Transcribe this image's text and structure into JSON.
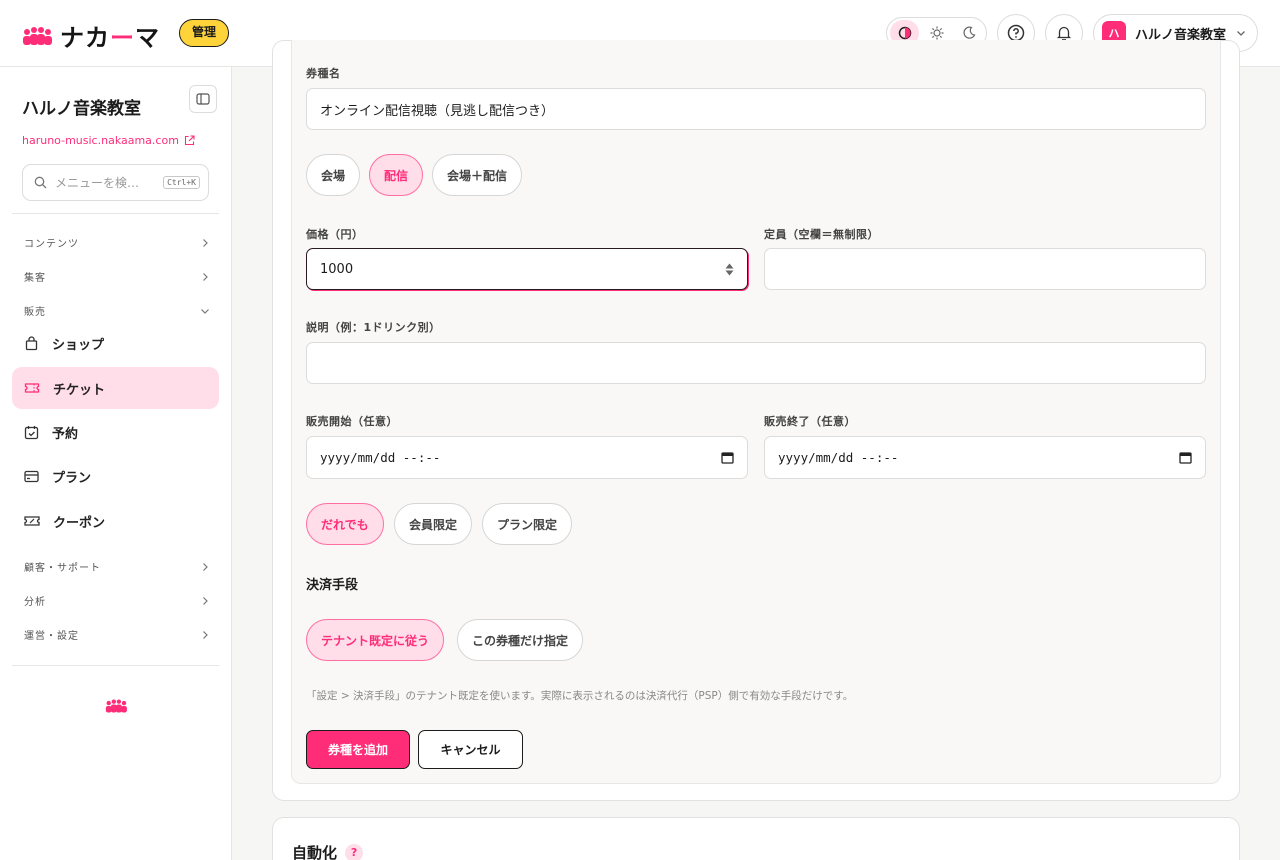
{
  "header": {
    "logo_prefix": "ナカ",
    "logo_accent": "ー",
    "logo_suffix": "マ",
    "admin_badge": "管理",
    "account": {
      "avatar_initial": "ハ",
      "name": "ハルノ音楽教室"
    },
    "accent_color": "#ff2d78"
  },
  "sidebar": {
    "site_name": "ハルノ音楽教室",
    "site_url": "haruno-music.nakaama.com",
    "search": {
      "placeholder": "メニューを検…",
      "shortcut": "Ctrl+K"
    },
    "sections": {
      "contents": "コンテンツ",
      "marketing": "集客",
      "sales": "販売",
      "customers": "顧客・サポート",
      "analytics": "分析",
      "operations": "運営・設定"
    },
    "items": {
      "shop": "ショップ",
      "ticket": "チケット",
      "reservation": "予約",
      "plan": "プラン",
      "coupon": "クーポン"
    }
  },
  "form": {
    "ticket_name": {
      "label": "券種名",
      "value": "オンライン配信視聴（見逃し配信つき）"
    },
    "venue_type": {
      "options": [
        "会場",
        "配信",
        "会場＋配信"
      ],
      "selected": "配信"
    },
    "price": {
      "label": "価格（円）",
      "value": "1000"
    },
    "capacity": {
      "label": "定員（空欄＝無制限）",
      "value": ""
    },
    "description": {
      "label": "説明（例：1ドリンク別）",
      "value": ""
    },
    "sale_start": {
      "label": "販売開始（任意）",
      "value": "yyyy/mm/dd --:--"
    },
    "sale_end": {
      "label": "販売終了（任意）",
      "value": "yyyy/mm/dd --:--"
    },
    "audience": {
      "options": [
        "だれでも",
        "会員限定",
        "プラン限定"
      ],
      "selected": "だれでも"
    },
    "payment": {
      "heading": "決済手段",
      "options": [
        "テナント既定に従う",
        "この券種だけ指定"
      ],
      "selected": "テナント既定に従う",
      "note": "「設定 > 決済手段」のテナント既定を使います。実際に表示されるのは決済代行（PSP）側で有効な手段だけです。"
    },
    "submit_label": "券種を追加",
    "cancel_label": "キャンセル"
  },
  "automation": {
    "title": "自動化",
    "help": "?"
  }
}
